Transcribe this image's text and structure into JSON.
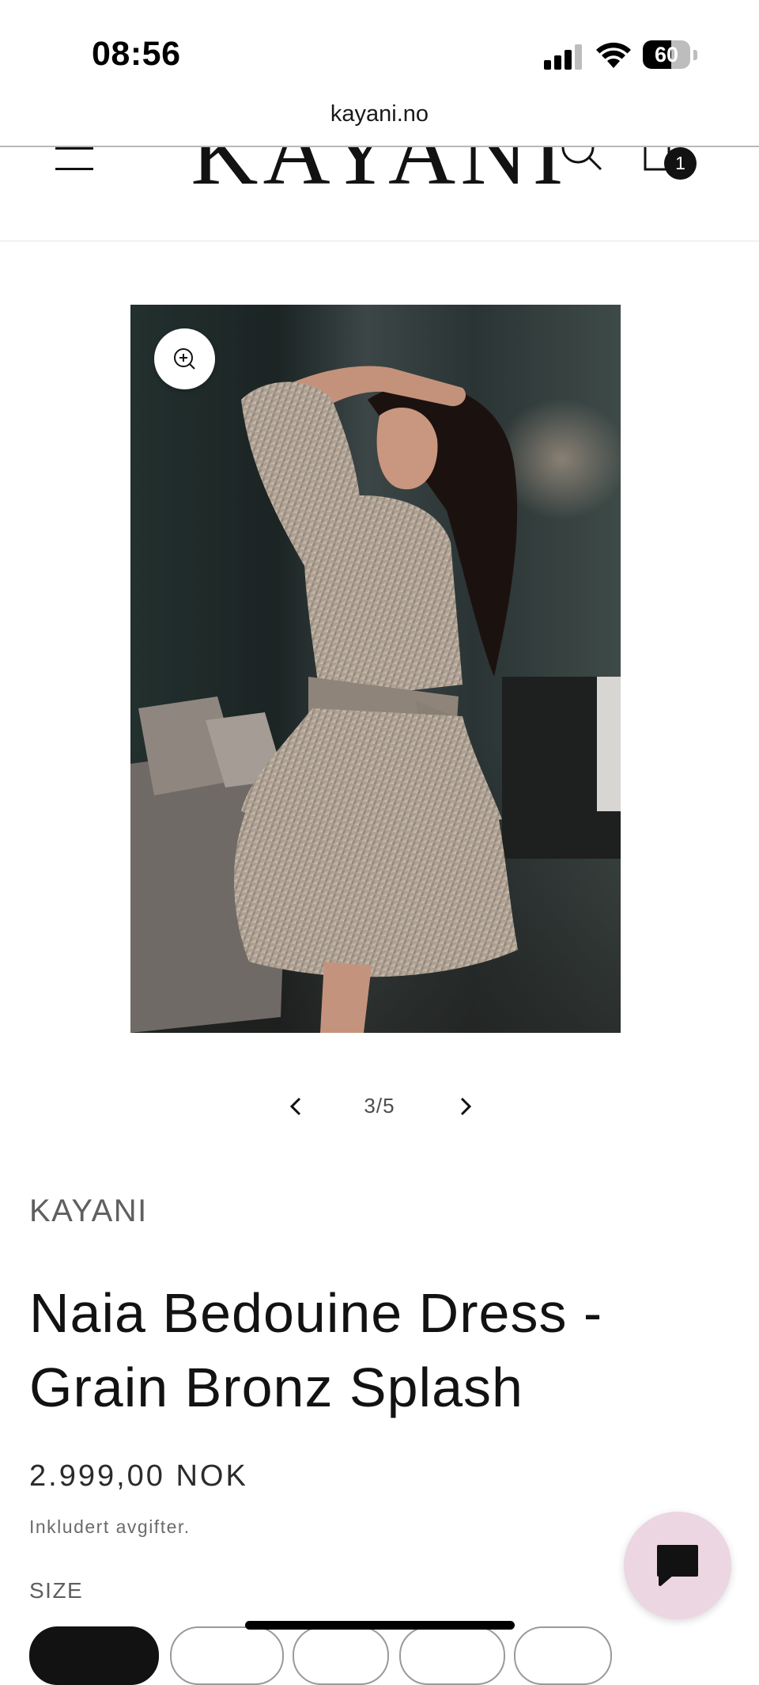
{
  "status_bar": {
    "time": "08:56",
    "battery_level": "60",
    "battery_fraction": 0.6
  },
  "browser": {
    "url": "kayani.no"
  },
  "header": {
    "logo": "KAYANI",
    "cart_count": "1",
    "icons": [
      "menu-icon",
      "search-icon",
      "cart-icon"
    ]
  },
  "gallery": {
    "counter": "3/5",
    "icons": [
      "zoom-in-icon",
      "chevron-left-icon",
      "chevron-right-icon"
    ]
  },
  "product": {
    "vendor": "KAYANI",
    "title": "Naia Bedouine Dress - Grain Bronz Splash",
    "price": "2.999,00 NOK",
    "tax_note": "Inkludert avgifter.",
    "size_label": "SIZE"
  },
  "chat": {
    "icon": "chat-icon",
    "color": "#ecd6e1"
  }
}
